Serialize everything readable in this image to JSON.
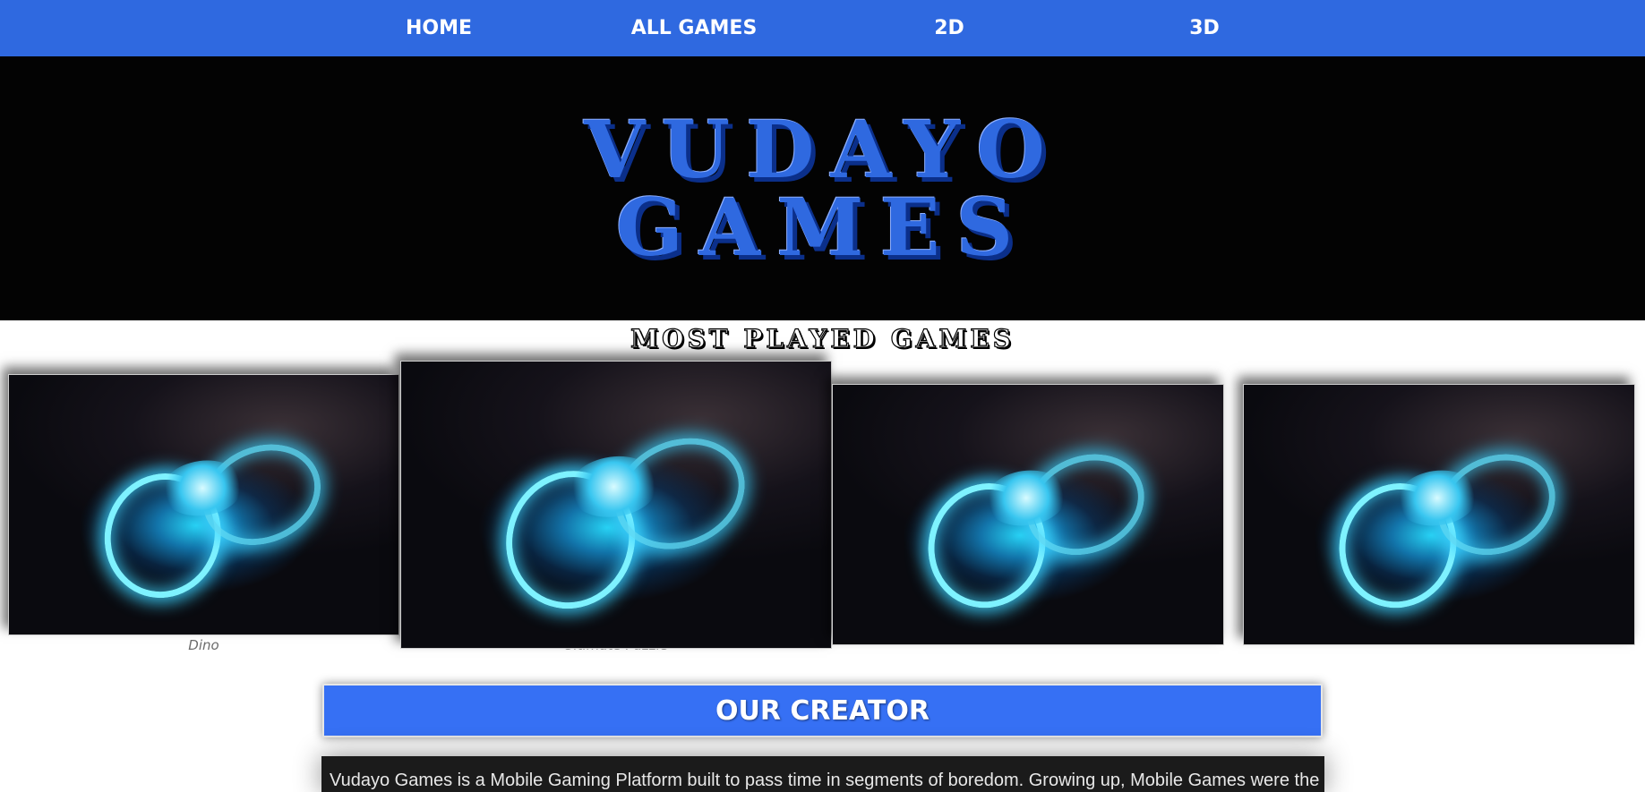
{
  "nav": {
    "items": [
      {
        "label": "HOME"
      },
      {
        "label": "ALL GAMES"
      },
      {
        "label": "2D"
      },
      {
        "label": "3D"
      }
    ]
  },
  "colors": {
    "nav_bg": "#2f69e0",
    "hero_bg": "#030303",
    "accent": "#3670f4",
    "creator_box_bg": "#1b1b1b"
  },
  "hero": {
    "logo_line1": "VUDAYO",
    "logo_line2": "GAMES"
  },
  "most_played": {
    "title": "MOST PLAYED GAMES",
    "games": [
      {
        "caption": "Dino",
        "image": "glowing-controller"
      },
      {
        "caption": "Ultimate Puzzle",
        "image": "glowing-controller"
      },
      {
        "caption": "",
        "image": "glowing-controller"
      },
      {
        "caption": "",
        "image": "glowing-controller"
      }
    ]
  },
  "creator": {
    "title": "OUR CREATOR",
    "text": "Vudayo Games is a Mobile Gaming Platform built to pass time in segments of boredom. Growing up, Mobile Games were the"
  }
}
